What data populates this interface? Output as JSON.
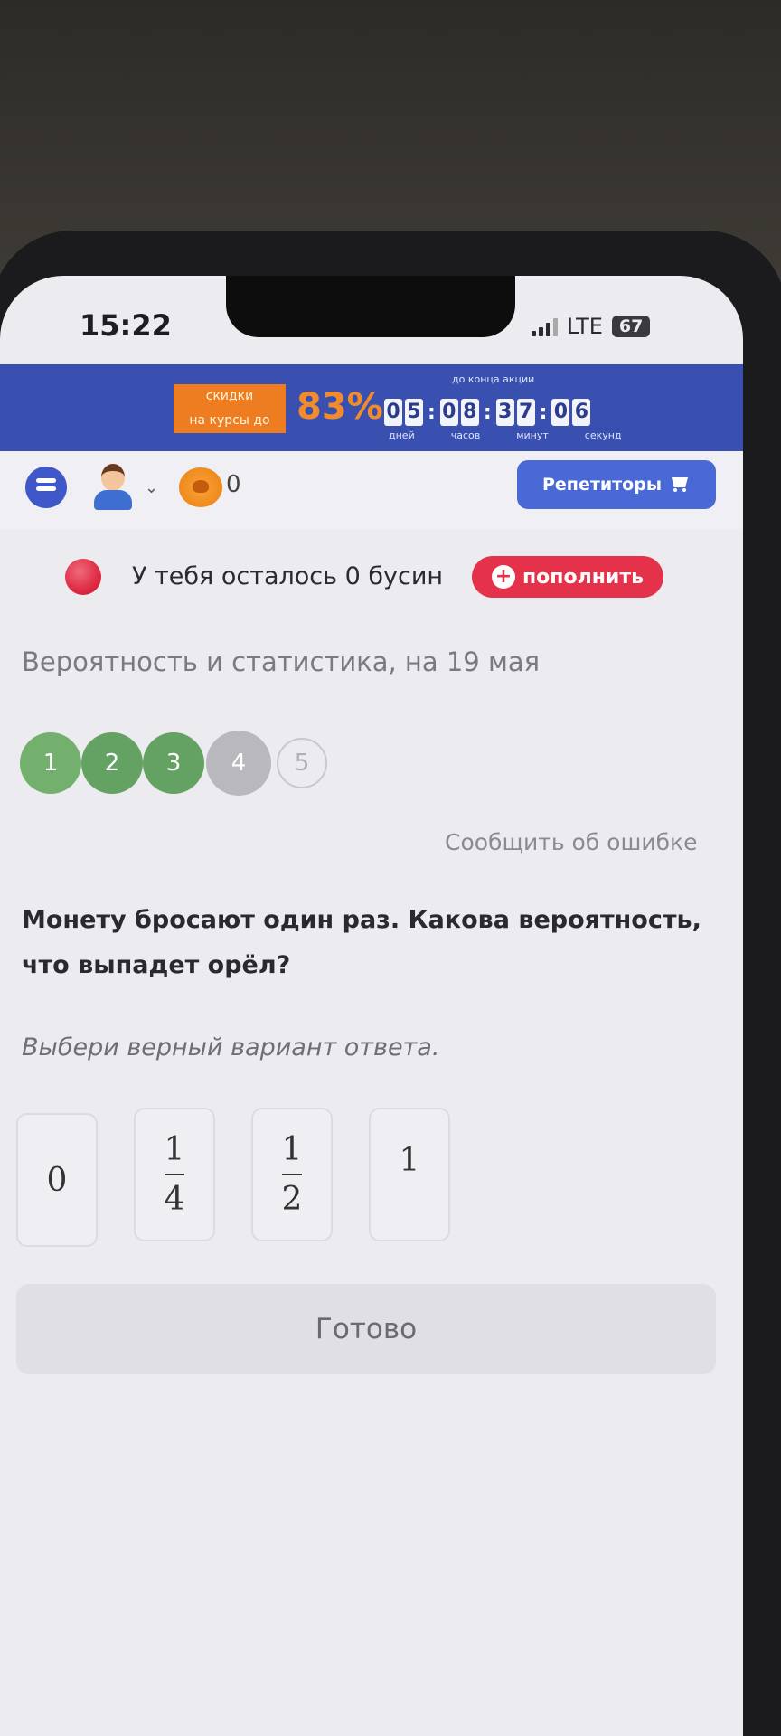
{
  "status_bar": {
    "time": "15:22",
    "network": "LTE",
    "battery": "67"
  },
  "promo": {
    "label_line1": "скидки",
    "label_line2": "на курсы до",
    "percent": "83%",
    "caption": "до конца акции",
    "timer": {
      "days": [
        "0",
        "5"
      ],
      "hours": [
        "0",
        "8"
      ],
      "minutes": [
        "3",
        "7"
      ],
      "seconds": [
        "0",
        "6"
      ]
    },
    "units": {
      "days": "дней",
      "hours": "часов",
      "minutes": "минут",
      "seconds": "секунд"
    }
  },
  "appbar": {
    "coins": "0",
    "tutors_label": "Репетиторы"
  },
  "beads": {
    "text": "У тебя осталось 0 бусин",
    "topup_label": "пополнить"
  },
  "topic": "Вероятность и статистика, на 19 мая",
  "steps": [
    {
      "label": "1",
      "state": "done"
    },
    {
      "label": "2",
      "state": "done"
    },
    {
      "label": "3",
      "state": "done"
    },
    {
      "label": "4",
      "state": "current"
    },
    {
      "label": "5",
      "state": "todo"
    }
  ],
  "report_link": "Сообщить об ошибке",
  "question": "Монету бросают один раз. Какова вероятность, что выпадет орёл?",
  "hint": "Выбери верный вариант ответа.",
  "options": [
    {
      "value": "0"
    },
    {
      "numerator": "1",
      "denominator": "4"
    },
    {
      "numerator": "1",
      "denominator": "2"
    },
    {
      "value": "1"
    }
  ],
  "done_label": "Готово",
  "colors": {
    "promo_bg": "#3a50b0",
    "accent_orange": "#f28b2c",
    "primary_blue": "#4a68d6",
    "danger_red": "#e4324a",
    "step_done": "#63a262",
    "step_current": "#b9b8bd"
  }
}
